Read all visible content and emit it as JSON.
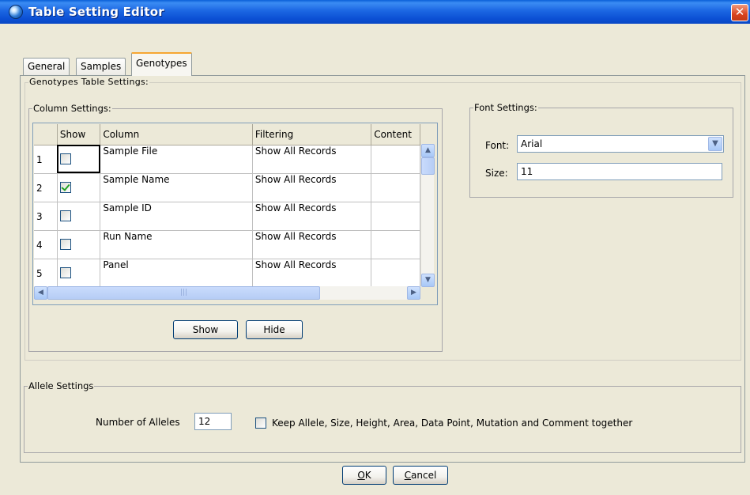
{
  "window": {
    "title": "Table Setting Editor",
    "close_label": "✕"
  },
  "tabs": [
    {
      "label": "General"
    },
    {
      "label": "Samples"
    },
    {
      "label": "Genotypes"
    }
  ],
  "genotypes": {
    "group_title": "Genotypes Table Settings:",
    "column_settings": {
      "title": "Column Settings:",
      "headers": [
        "",
        "Show",
        "Column",
        "Filtering",
        "Content"
      ],
      "rows": [
        {
          "num": "1",
          "show": false,
          "column": "Sample File",
          "filtering": "Show All Records"
        },
        {
          "num": "2",
          "show": true,
          "column": "Sample Name",
          "filtering": "Show All Records"
        },
        {
          "num": "3",
          "show": false,
          "column": "Sample ID",
          "filtering": "Show All Records"
        },
        {
          "num": "4",
          "show": false,
          "column": "Run Name",
          "filtering": "Show All Records"
        },
        {
          "num": "5",
          "show": false,
          "column": "Panel",
          "filtering": "Show All Records"
        }
      ],
      "show_button": "Show",
      "hide_button": "Hide"
    },
    "font_settings": {
      "title": "Font Settings:",
      "font_label": "Font:",
      "font_value": "Arial",
      "size_label": "Size:",
      "size_value": "11"
    }
  },
  "allele_settings": {
    "title": "Allele Settings",
    "num_alleles_label": "Number of Alleles",
    "num_alleles_value": "12",
    "keep_together_label": "Keep Allele, Size, Height, Area, Data Point, Mutation and Comment together",
    "keep_together_checked": false
  },
  "footer": {
    "ok_label": "OK",
    "cancel_label": "Cancel"
  }
}
